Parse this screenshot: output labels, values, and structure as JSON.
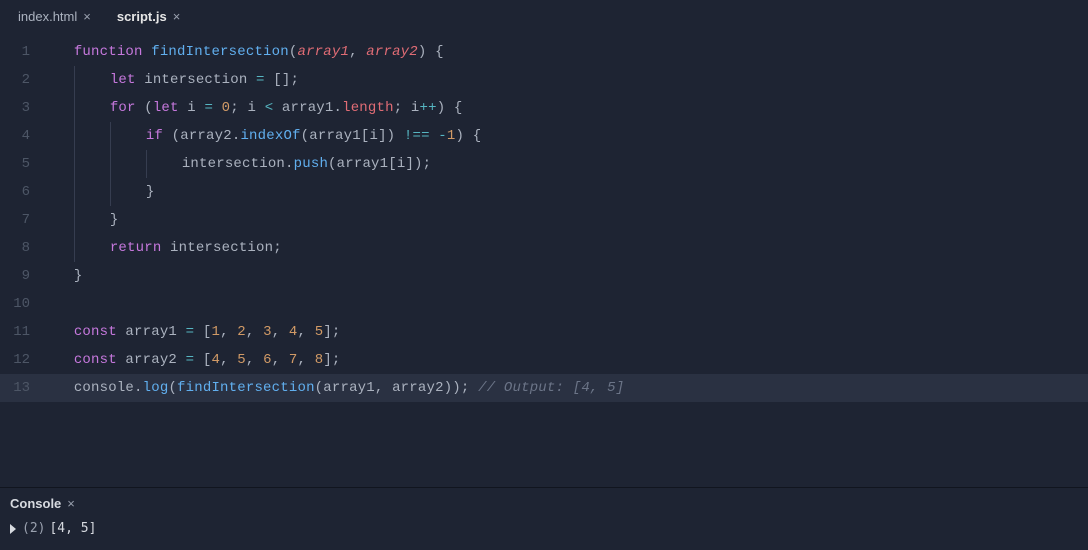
{
  "tabs": [
    {
      "label": "index.html",
      "active": false
    },
    {
      "label": "script.js",
      "active": true
    }
  ],
  "close_glyph": "×",
  "code": {
    "l1": {
      "a": "function",
      "b": "findIntersection",
      "c": "(",
      "d": "array1",
      "e": ", ",
      "f": "array2",
      "g": ")",
      "h": " {"
    },
    "l2": {
      "a": "let",
      "b": " intersection ",
      "c": "=",
      "d": " [];"
    },
    "l3": {
      "a": "for",
      "b": " (",
      "c": "let",
      "d": " i ",
      "e": "=",
      "f": " ",
      "g": "0",
      "h": "; i ",
      "i": "<",
      "j": " array1.",
      "k": "length",
      "l": "; i",
      "m": "++",
      "n": ") {"
    },
    "l4": {
      "a": "if",
      "b": " (array2.",
      "c": "indexOf",
      "d": "(array1[i]) ",
      "e": "!==",
      "f": " ",
      "g": "-",
      "h": "1",
      "i": ") {"
    },
    "l5": {
      "a": "intersection.",
      "b": "push",
      "c": "(array1[i]);"
    },
    "l6": {
      "a": "}"
    },
    "l7": {
      "a": "}"
    },
    "l8": {
      "a": "return",
      "b": " intersection;"
    },
    "l9": {
      "a": "}"
    },
    "l11": {
      "a": "const",
      "b": " array1 ",
      "c": "=",
      "d": " [",
      "e": "1",
      "f": ", ",
      "g": "2",
      "h": ", ",
      "i": "3",
      "j": ", ",
      "k": "4",
      "l": ", ",
      "m": "5",
      "n": "];"
    },
    "l12": {
      "a": "const",
      "b": " array2 ",
      "c": "=",
      "d": " [",
      "e": "4",
      "f": ", ",
      "g": "5",
      "h": ", ",
      "i": "6",
      "j": ", ",
      "k": "7",
      "l": ", ",
      "m": "8",
      "n": "];"
    },
    "l13": {
      "a": "console.",
      "b": "log",
      "c": "(",
      "d": "findIntersection",
      "e": "(array1, array2));",
      "f": " // Output: [4, 5]"
    }
  },
  "line_numbers": [
    "1",
    "2",
    "3",
    "4",
    "5",
    "6",
    "7",
    "8",
    "9",
    "10",
    "11",
    "12",
    "13"
  ],
  "console": {
    "title": "Console",
    "output_count": "(2)",
    "output_text": "[4, 5]"
  }
}
